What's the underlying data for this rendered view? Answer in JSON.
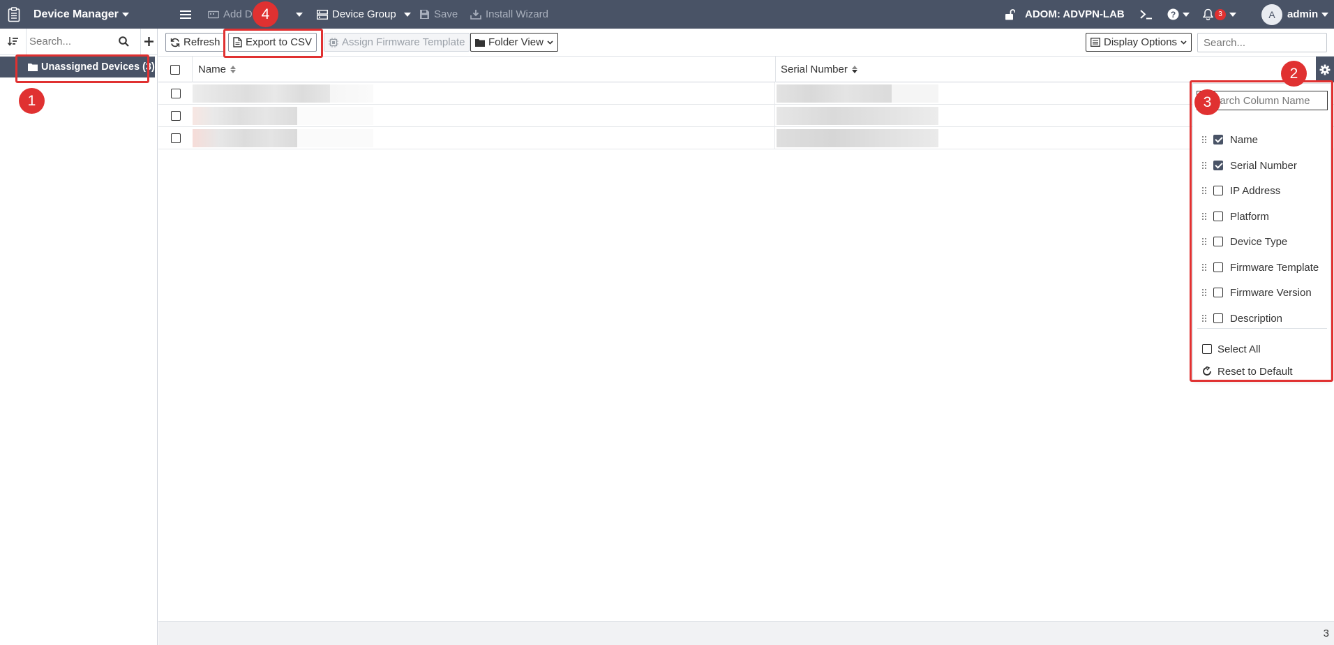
{
  "topbar": {
    "app_title": "Device Manager",
    "add_device_label": "Add De",
    "device_group_label": "Device Group",
    "save_label": "Save",
    "install_wizard_label": "Install Wizard",
    "adom_label": "ADOM: ADVPN-LAB",
    "notification_count": "3",
    "avatar_letter": "A",
    "user_label": "admin"
  },
  "sidebar": {
    "search_placeholder": "Search...",
    "tree_item_label": "Unassigned Devices (3)"
  },
  "toolbar": {
    "refresh_label": "Refresh",
    "export_label": "Export to CSV",
    "assign_firmware_label": "Assign Firmware Template",
    "folder_view_label": "Folder View",
    "display_options_label": "Display Options",
    "search_placeholder": "Search..."
  },
  "grid": {
    "columns": [
      "Name",
      "Serial Number"
    ],
    "row_count": 3,
    "footer_count": "3"
  },
  "column_panel": {
    "search_placeholder": "Search Column Name",
    "columns": [
      {
        "label": "Name",
        "checked": true
      },
      {
        "label": "Serial Number",
        "checked": true
      },
      {
        "label": "IP Address",
        "checked": false
      },
      {
        "label": "Platform",
        "checked": false
      },
      {
        "label": "Device Type",
        "checked": false
      },
      {
        "label": "Firmware Template",
        "checked": false
      },
      {
        "label": "Firmware Version",
        "checked": false
      },
      {
        "label": "Description",
        "checked": false
      }
    ],
    "select_all_label": "Select All",
    "reset_label": "Reset to Default"
  },
  "annotations": [
    "1",
    "2",
    "3",
    "4"
  ],
  "colors": {
    "topbar_bg": "#495366",
    "annotation_red": "#e03131"
  }
}
